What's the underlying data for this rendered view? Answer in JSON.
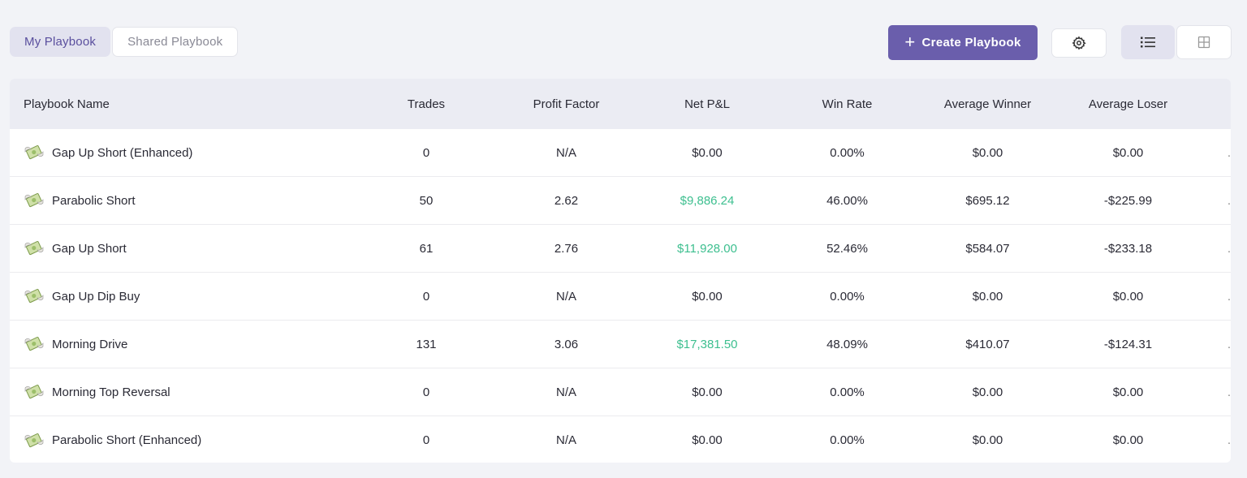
{
  "tabs": [
    {
      "label": "My Playbook",
      "active": true
    },
    {
      "label": "Shared Playbook",
      "active": false
    }
  ],
  "toolbar": {
    "create_label": "Create Playbook",
    "accent": "#6a5eac"
  },
  "table": {
    "headers": [
      "Playbook Name",
      "Trades",
      "Profit Factor",
      "Net P&L",
      "Win Rate",
      "Average Winner",
      "Average Loser"
    ],
    "rows": [
      {
        "name": "Gap Up Short (Enhanced)",
        "trades": "0",
        "profit_factor": "N/A",
        "net_pnl": "$0.00",
        "win_rate": "0.00%",
        "avg_winner": "$0.00",
        "avg_loser": "$0.00"
      },
      {
        "name": "Parabolic Short",
        "trades": "50",
        "profit_factor": "2.62",
        "net_pnl": "$9,886.24",
        "win_rate": "46.00%",
        "avg_winner": "$695.12",
        "avg_loser": "-$225.99"
      },
      {
        "name": "Gap Up Short",
        "trades": "61",
        "profit_factor": "2.76",
        "net_pnl": "$11,928.00",
        "win_rate": "52.46%",
        "avg_winner": "$584.07",
        "avg_loser": "-$233.18"
      },
      {
        "name": "Gap Up Dip Buy",
        "trades": "0",
        "profit_factor": "N/A",
        "net_pnl": "$0.00",
        "win_rate": "0.00%",
        "avg_winner": "$0.00",
        "avg_loser": "$0.00"
      },
      {
        "name": "Morning Drive",
        "trades": "131",
        "profit_factor": "3.06",
        "net_pnl": "$17,381.50",
        "win_rate": "48.09%",
        "avg_winner": "$410.07",
        "avg_loser": "-$124.31"
      },
      {
        "name": "Morning Top Reversal",
        "trades": "0",
        "profit_factor": "N/A",
        "net_pnl": "$0.00",
        "win_rate": "0.00%",
        "avg_winner": "$0.00",
        "avg_loser": "$0.00"
      },
      {
        "name": "Parabolic Short (Enhanced)",
        "trades": "0",
        "profit_factor": "N/A",
        "net_pnl": "$0.00",
        "win_rate": "0.00%",
        "avg_winner": "$0.00",
        "avg_loser": "$0.00"
      }
    ],
    "positive_color": "#3dbf8f",
    "row_icon": "money-with-wings-icon"
  }
}
